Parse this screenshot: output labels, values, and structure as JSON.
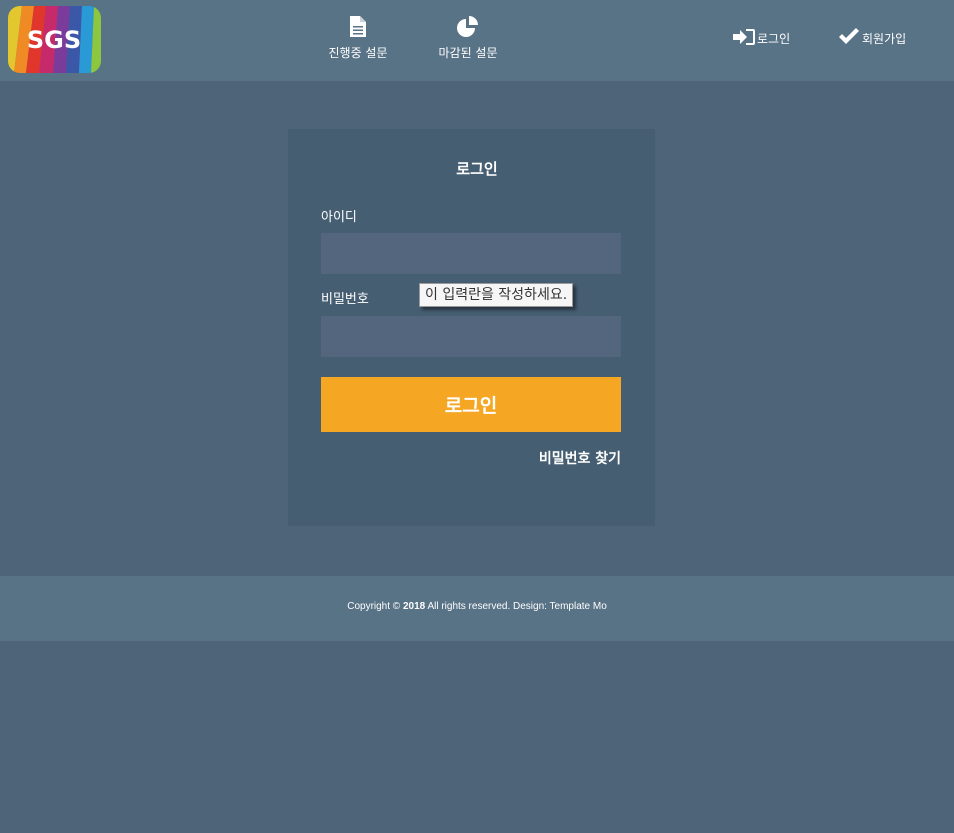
{
  "header": {
    "logo_text": "SGS",
    "nav": [
      {
        "label": "진행중 설문",
        "icon": "document-icon"
      },
      {
        "label": "마감된 설문",
        "icon": "pie-chart-icon"
      }
    ],
    "user_links": [
      {
        "label": "로그인",
        "icon": "sign-in-icon"
      },
      {
        "label": "회원가입",
        "icon": "check-icon"
      }
    ]
  },
  "login_form": {
    "title": "로그인",
    "id_label": "아이디",
    "id_value": "",
    "password_label": "비밀번호",
    "password_value": "",
    "validation_tooltip": "이 입력란을 작성하세요.",
    "submit_label": "로그인",
    "find_password_label": "비밀번호 찾기"
  },
  "footer": {
    "copyright_prefix": "Copyright ©",
    "year": "2018",
    "copyright_suffix": "All rights reserved. Design: Template Mo"
  },
  "colors": {
    "background": "#4e6478",
    "header": "#587286",
    "panel": "#465e72",
    "input": "#54657e",
    "accent": "#f5a623"
  }
}
